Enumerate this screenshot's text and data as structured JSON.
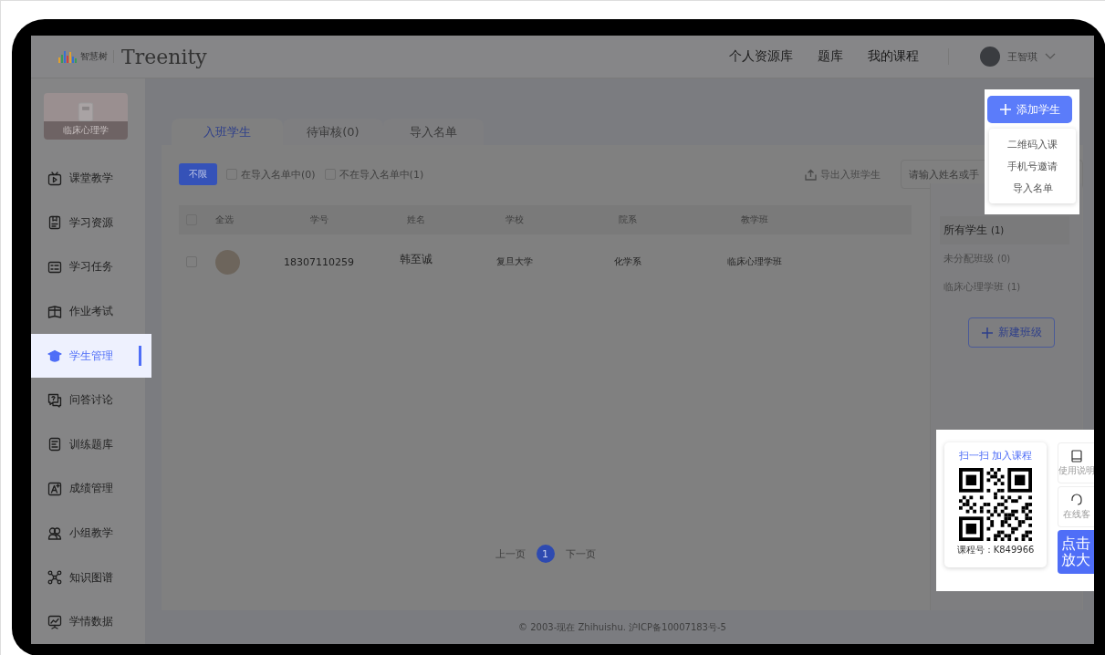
{
  "header": {
    "logo_mark": "智慧树",
    "logo_text": "Treenity",
    "nav": [
      {
        "label": "个人资源库"
      },
      {
        "label": "题库"
      },
      {
        "label": "我的课程"
      }
    ],
    "user": {
      "name": "王智琪"
    }
  },
  "sidebar": {
    "course": {
      "title": "临床心理学"
    },
    "items": [
      {
        "label": "课堂教学",
        "selected": false
      },
      {
        "label": "学习资源",
        "selected": false
      },
      {
        "label": "学习任务",
        "selected": false
      },
      {
        "label": "作业考试",
        "selected": false
      },
      {
        "label": "学生管理",
        "selected": true
      },
      {
        "label": "问答讨论",
        "selected": false
      },
      {
        "label": "训练题库",
        "selected": false
      },
      {
        "label": "成绩管理",
        "selected": false
      },
      {
        "label": "小组教学",
        "selected": false
      },
      {
        "label": "知识图谱",
        "selected": false
      },
      {
        "label": "学情数据",
        "selected": false
      }
    ]
  },
  "tabs": [
    {
      "label": "入班学生",
      "selected": true
    },
    {
      "label": "待审核(0)",
      "selected": false
    },
    {
      "label": "导入名单",
      "selected": false
    }
  ],
  "filters": {
    "all": {
      "label": "不限",
      "selected": true
    },
    "checks": [
      {
        "label": "在导入名单中(0)",
        "checked": false
      },
      {
        "label": "不在导入名单中(1)",
        "checked": false
      }
    ]
  },
  "export": "导出入班学生",
  "search": {
    "placeholder": "请输入姓名或手"
  },
  "table": {
    "select_all": {
      "label": "全选",
      "checked": false
    },
    "columns": [
      "学号",
      "姓名",
      "学校",
      "院系",
      "教学班"
    ],
    "rows": [
      {
        "checked": false,
        "cells": [
          "18307110259",
          "韩至诚",
          "复旦大学",
          "化学系",
          "临床心理学班"
        ]
      }
    ]
  },
  "classes": [
    {
      "label": "所有学生",
      "count": "(1)",
      "selected": true
    },
    {
      "label": "未分配班级",
      "count": "(0)",
      "selected": false
    },
    {
      "label": "临床心理学班",
      "count": "(1)",
      "selected": false
    }
  ],
  "new_class": "新建班级",
  "pagination": {
    "prev": "上一页",
    "pages": [
      {
        "label": "1",
        "selected": true
      }
    ],
    "next": "下一页"
  },
  "footer": "© 2003-现在 Zhihuishu. 沪ICP备10007183号-5",
  "add_student": {
    "button": "添加学生",
    "menu": [
      "二维码入课",
      "手机号邀请",
      "导入名单"
    ]
  },
  "qr_panel": {
    "title": "扫一扫 加入课程",
    "course_code": "课程号：K849966"
  },
  "side_tools": [
    {
      "label": "使用说明",
      "kind": "tool"
    },
    {
      "label": "在线客",
      "kind": "tool"
    },
    {
      "label": "点击放大",
      "kind": "action"
    }
  ]
}
